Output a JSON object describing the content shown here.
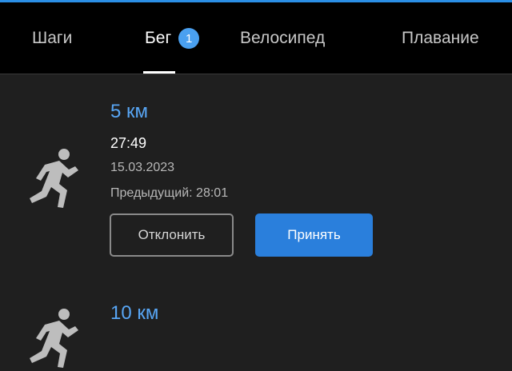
{
  "tabs": [
    {
      "label": "Шаги"
    },
    {
      "label": "Бег",
      "badge": "1",
      "active": true
    },
    {
      "label": "Велосипед"
    },
    {
      "label": "Плавание"
    }
  ],
  "records": [
    {
      "icon": "running-person-icon",
      "distance": "5 км",
      "time": "27:49",
      "date": "15.03.2023",
      "previous": "Предыдущий: 28:01",
      "decline_label": "Отклонить",
      "accept_label": "Принять"
    },
    {
      "icon": "running-person-icon",
      "distance": "10 км"
    }
  ],
  "colors": {
    "accent": "#2b8fe6",
    "link": "#58a6f5",
    "button_primary": "#2a7fdc",
    "background": "#1f1f1f",
    "tabbar": "#000000"
  }
}
